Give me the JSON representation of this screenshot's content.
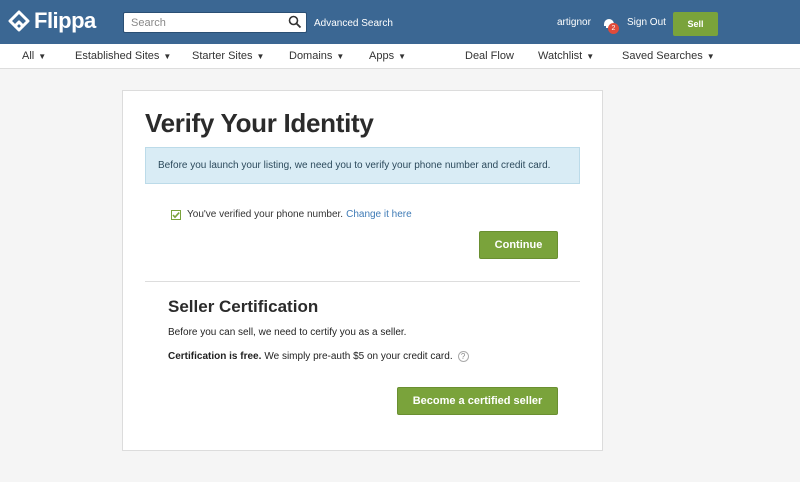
{
  "header": {
    "logo_text": "Flippa",
    "search_placeholder": "Search",
    "advanced_search": "Advanced Search",
    "username": "artignor",
    "notification_count": "2",
    "sign_out": "Sign Out",
    "sell_label": "Sell",
    "bg_color": "#3b6793"
  },
  "nav": {
    "items": [
      {
        "label": "All",
        "caret": "▼"
      },
      {
        "label": "Established Sites",
        "caret": "▼"
      },
      {
        "label": "Starter Sites",
        "caret": "▼"
      },
      {
        "label": "Domains",
        "caret": "▼"
      },
      {
        "label": "Apps",
        "caret": "▼"
      },
      {
        "label": "Deal Flow",
        "caret": ""
      },
      {
        "label": "Watchlist",
        "caret": "▼"
      },
      {
        "label": "Saved Searches",
        "caret": "▼"
      }
    ]
  },
  "main": {
    "title": "Verify Your Identity",
    "alert": "Before you launch your listing, we need you to verify your phone number and credit card.",
    "verified_text": "You've verified your phone number.",
    "change_link": "Change it here",
    "continue_label": "Continue",
    "section_title": "Seller Certification",
    "section_desc": "Before you can sell, we need to certify you as a seller.",
    "cert_bold": "Certification is free.",
    "cert_text": "We simply pre-auth $5 on your credit card.",
    "help_glyph": "?",
    "certify_label": "Become a certified seller",
    "accent_color": "#7aa33b"
  }
}
